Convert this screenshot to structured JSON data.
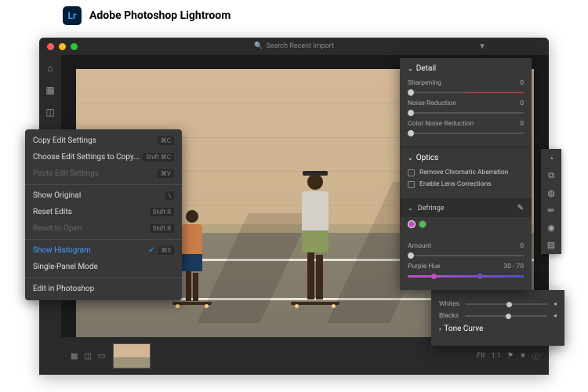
{
  "header": {
    "logo": "Lr",
    "title": "Adobe Photoshop Lightroom"
  },
  "search": {
    "placeholder": "Search Recent Import",
    "icon": "search-icon"
  },
  "sidebar": {
    "items": [
      "home",
      "photos",
      "share",
      "learn"
    ]
  },
  "filmstrip": {
    "fit": "Fit",
    "ratio": "1:1",
    "flag_icons": [
      "grid",
      "compare",
      "detail"
    ]
  },
  "context_menu": {
    "items": [
      {
        "label": "Copy Edit Settings",
        "shortcut": "⌘C",
        "enabled": true
      },
      {
        "label": "Choose Edit Settings to Copy...",
        "shortcut": "Shift ⌘C",
        "enabled": true
      },
      {
        "label": "Paste Edit Settings",
        "shortcut": "⌘V",
        "enabled": false
      },
      {
        "sep": true
      },
      {
        "label": "Show Original",
        "shortcut": "\\",
        "enabled": true
      },
      {
        "label": "Reset Edits",
        "shortcut": "Shift R",
        "enabled": true
      },
      {
        "label": "Reset to Open",
        "shortcut": "Shift R",
        "enabled": false
      },
      {
        "sep": true
      },
      {
        "label": "Show Histogram",
        "shortcut": "⌘0",
        "enabled": true,
        "active": true,
        "checked": true
      },
      {
        "label": "Single-Panel Mode",
        "shortcut": "",
        "enabled": true
      },
      {
        "sep": true
      },
      {
        "label": "Edit in Photoshop",
        "shortcut": "",
        "enabled": true
      }
    ]
  },
  "detail_panel": {
    "title": "Detail",
    "sharpening": {
      "label": "Sharpening",
      "value": "0"
    },
    "noise": {
      "label": "Noise Reduction",
      "value": "0"
    },
    "color_noise": {
      "label": "Color Noise Reduction",
      "value": "0"
    }
  },
  "optics_panel": {
    "title": "Optics",
    "chromatic": "Remove Chromatic Aberration",
    "lens": "Enable Lens Corrections",
    "defringe": "Defringe",
    "amount": {
      "label": "Amount",
      "value": "0"
    },
    "purple_hue": {
      "label": "Purple Hue",
      "value": "30 - 70"
    }
  },
  "tone_panel": {
    "whites": "Whites",
    "blacks": "Blacks",
    "curve": "Tone Curve"
  },
  "toolbar": {
    "tools": [
      "adjust",
      "crop",
      "heal",
      "brush",
      "mask",
      "grad"
    ]
  }
}
